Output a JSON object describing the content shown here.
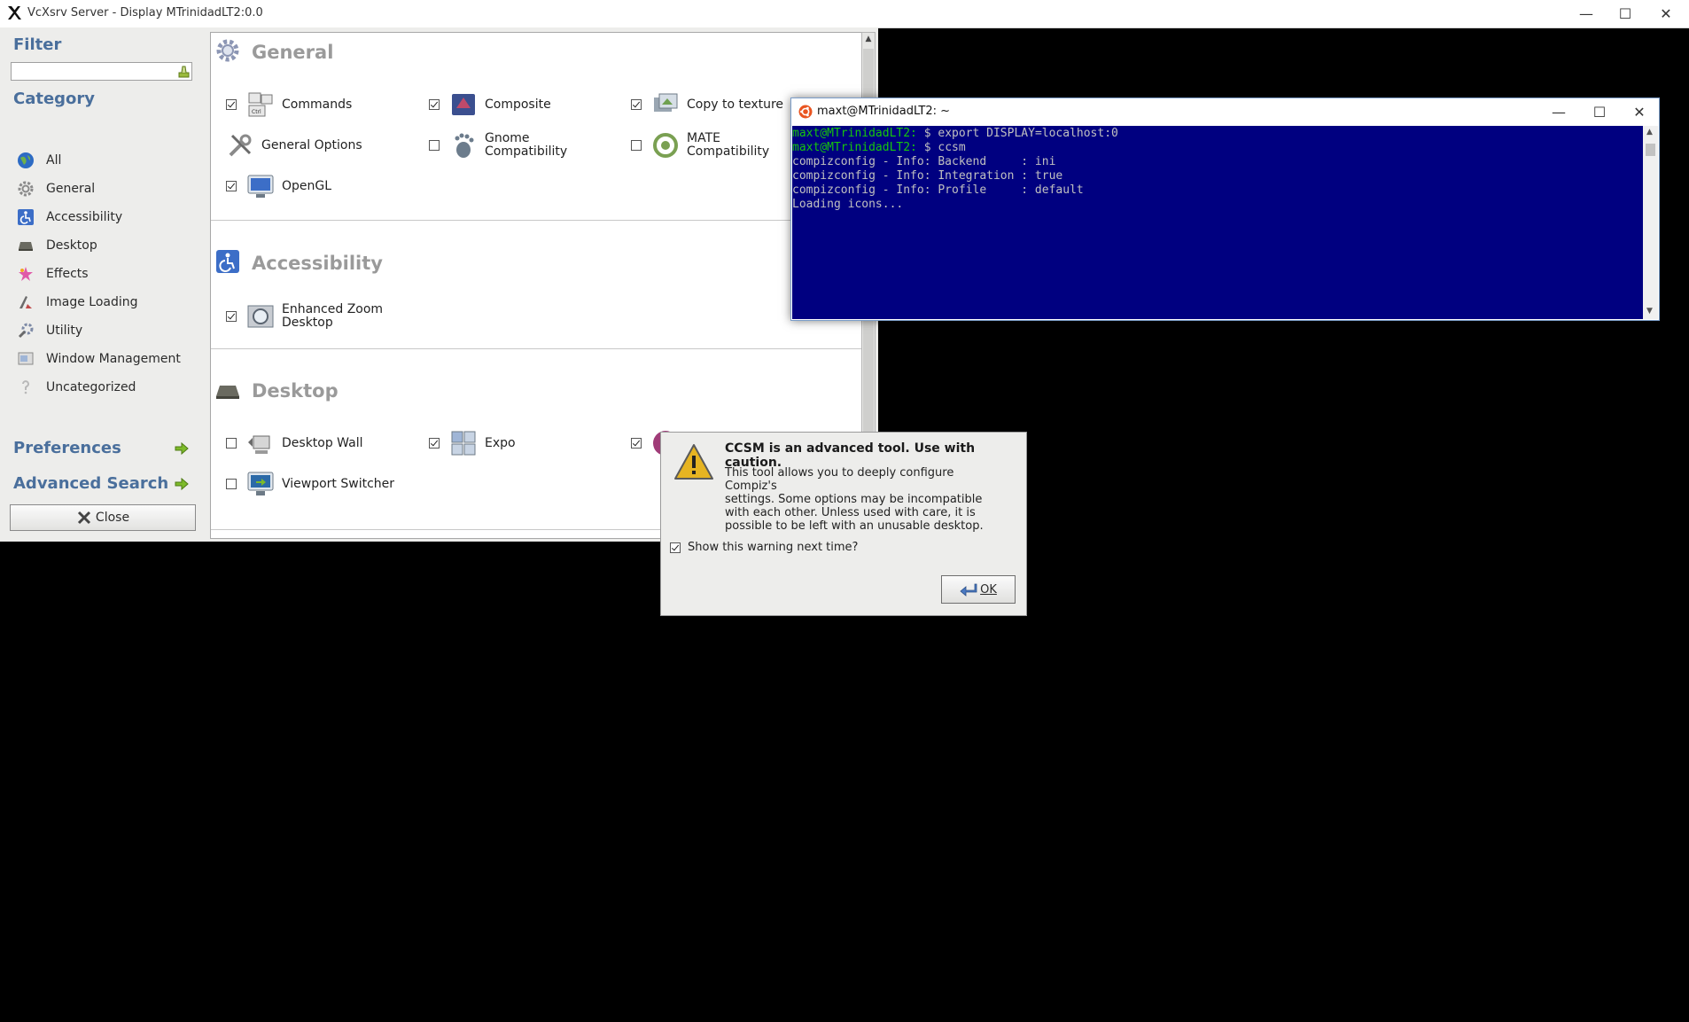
{
  "outer_window": {
    "title": "VcXsrv Server - Display MTrinidadLT2:0.0",
    "min_label": "—",
    "max_label": "☐",
    "close_label": "✕"
  },
  "ccsm": {
    "sidebar": {
      "filter_label": "Filter",
      "filter_value": "",
      "category_label": "Category",
      "categories": [
        {
          "label": "All",
          "icon": "globe-icon"
        },
        {
          "label": "General",
          "icon": "gear-icon"
        },
        {
          "label": "Accessibility",
          "icon": "accessibility-icon"
        },
        {
          "label": "Desktop",
          "icon": "desktop-icon"
        },
        {
          "label": "Effects",
          "icon": "effects-icon"
        },
        {
          "label": "Image Loading",
          "icon": "image-loading-icon"
        },
        {
          "label": "Utility",
          "icon": "utility-icon"
        },
        {
          "label": "Window Management",
          "icon": "window-management-icon"
        },
        {
          "label": "Uncategorized",
          "icon": "uncategorized-icon"
        }
      ],
      "preferences_label": "Preferences",
      "advanced_search_label": "Advanced Search",
      "close_label": "Close"
    },
    "sections": {
      "general": {
        "title": "General",
        "plugins": [
          {
            "label": "Commands",
            "checked": true,
            "has_checkbox": true
          },
          {
            "label": "Composite",
            "checked": true,
            "has_checkbox": true
          },
          {
            "label": "Copy to texture",
            "checked": true,
            "has_checkbox": true
          },
          {
            "label": "General Options",
            "checked": false,
            "has_checkbox": false
          },
          {
            "label_line1": "Gnome",
            "label_line2": "Compatibility",
            "checked": false,
            "has_checkbox": true
          },
          {
            "label_line1": "MATE",
            "label_line2": "Compatibility",
            "checked": false,
            "has_checkbox": true
          },
          {
            "label": "OpenGL",
            "checked": true,
            "has_checkbox": true
          }
        ]
      },
      "accessibility": {
        "title": "Accessibility",
        "plugins": [
          {
            "label_line1": "Enhanced Zoom",
            "label_line2": "Desktop",
            "checked": true,
            "has_checkbox": true
          }
        ]
      },
      "desktop": {
        "title": "Desktop",
        "plugins": [
          {
            "label": "Desktop Wall",
            "checked": false,
            "has_checkbox": true
          },
          {
            "label": "Expo",
            "checked": true,
            "has_checkbox": true
          },
          {
            "label": "",
            "checked": true,
            "has_checkbox": true
          },
          {
            "label": "Viewport Switcher",
            "checked": false,
            "has_checkbox": true
          }
        ]
      }
    }
  },
  "terminal": {
    "title": "maxt@MTrinidadLT2: ~",
    "lines": [
      {
        "prompt": "maxt@MTrinidadLT2:",
        "text": " $ export DISPLAY=localhost:0"
      },
      {
        "prompt": "maxt@MTrinidadLT2:",
        "text": " $ ccsm"
      },
      {
        "prompt": "",
        "text": "compizconfig - Info: Backend     : ini"
      },
      {
        "prompt": "",
        "text": "compizconfig - Info: Integration : true"
      },
      {
        "prompt": "",
        "text": "compizconfig - Info: Profile     : default"
      },
      {
        "prompt": "",
        "text": "Loading icons..."
      }
    ],
    "colors": {
      "background": "#000080",
      "prompt": "#16c60c",
      "text": "#c0c0c0"
    }
  },
  "warning_dialog": {
    "title": "CCSM is an advanced tool. Use with caution.",
    "body_lines": [
      "This tool allows you to deeply configure Compiz's",
      "settings. Some options may be incompatible",
      "with each other. Unless used with care, it is",
      "possible to be left with an unusable desktop."
    ],
    "show_warning_label": "Show this warning next time?",
    "show_warning_checked": true,
    "ok_label": "OK"
  }
}
